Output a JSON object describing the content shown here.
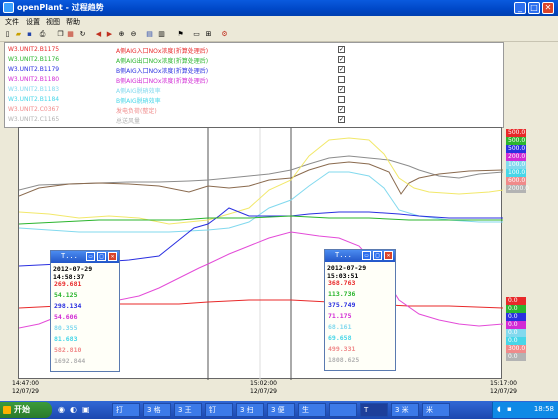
{
  "window": {
    "title": "openPlant - 过程趋势",
    "icon": "app-icon"
  },
  "menu": [
    "文件",
    "设置",
    "视图",
    "帮助"
  ],
  "tags": [
    {
      "name": "W3.UNIT2.B1175",
      "desc": "A侧AIG入口NOx浓度(折算处理后)",
      "color": "#e8292a",
      "checked": true
    },
    {
      "name": "W3.UNIT2.B1176",
      "desc": "A侧AIG出口NOx浓度(折算处理后)",
      "color": "#2bb52e",
      "checked": true
    },
    {
      "name": "W3.UNIT2.B1179",
      "desc": "B侧AIG入口NOx浓度(折算处理后)",
      "color": "#2a2fe0",
      "checked": true
    },
    {
      "name": "W3.UNIT2.B1180",
      "desc": "B侧AIG出口NOx浓度(折算处理后)",
      "color": "#d22bd5",
      "checked": false
    },
    {
      "name": "W3.UNIT2.B1183",
      "desc": "A侧AIG脱硝效率",
      "color": "#82d9ee",
      "checked": true
    },
    {
      "name": "W3.UNIT2.B1184",
      "desc": "B侧AIG脱硝效率",
      "color": "#47d6e8",
      "checked": false
    },
    {
      "name": "W3.UNIT2.C0367",
      "desc": "发电负荷(整定)",
      "color": "#f08a8a",
      "checked": true
    },
    {
      "name": "W3.UNIT2.C1165",
      "desc": "总送风量",
      "color": "#b3b3b3",
      "checked": true
    }
  ],
  "scale_top": [
    {
      "label": "500.0",
      "color": "#e8292a"
    },
    {
      "label": "500.0",
      "color": "#2bb52e"
    },
    {
      "label": "500.0",
      "color": "#2a2fe0"
    },
    {
      "label": "200.0",
      "color": "#d22bd5"
    },
    {
      "label": "100.0",
      "color": "#82d9ee"
    },
    {
      "label": "100.0",
      "color": "#47d6e8"
    },
    {
      "label": "600.0",
      "color": "#f08a8a"
    },
    {
      "label": "2000.0",
      "color": "#b3b3b3"
    }
  ],
  "scale_bottom": [
    {
      "label": "0.0",
      "color": "#e8292a"
    },
    {
      "label": "0.0",
      "color": "#2bb52e"
    },
    {
      "label": "0.0",
      "color": "#2a2fe0"
    },
    {
      "label": "0.0",
      "color": "#d22bd5"
    },
    {
      "label": "0.0",
      "color": "#82d9ee"
    },
    {
      "label": "0.0",
      "color": "#47d6e8"
    },
    {
      "label": "300.0",
      "color": "#f08a8a"
    },
    {
      "label": "0.0",
      "color": "#b3b3b3"
    }
  ],
  "time_axis": {
    "left": {
      "time": "14:47:00",
      "date": "12/07/29"
    },
    "mid": {
      "time": "15:02:00",
      "date": "12/07/29"
    },
    "right": {
      "time": "15:17:00",
      "date": "12/07/29"
    }
  },
  "popups": [
    {
      "title": "T...",
      "datetime": "2012-07-29 14:58:37",
      "values": [
        "269.681",
        "54.125",
        "298.134",
        "54.606",
        "80.355",
        "81.683",
        "582.810",
        "1692.844"
      ]
    },
    {
      "title": "T...",
      "datetime": "2012-07-29 15:03:51",
      "values": [
        "368.763",
        "113.736",
        "375.749",
        "71.175",
        "68.161",
        "69.658",
        "499.331",
        "1808.625"
      ]
    }
  ],
  "taskbar": {
    "start_label": "开始",
    "items": [
      "打",
      "3 格",
      "3 王",
      "钉",
      "3 扫",
      "3 便",
      "生",
      "",
      "T",
      "3 米",
      "米"
    ],
    "clock": "18:58"
  }
}
